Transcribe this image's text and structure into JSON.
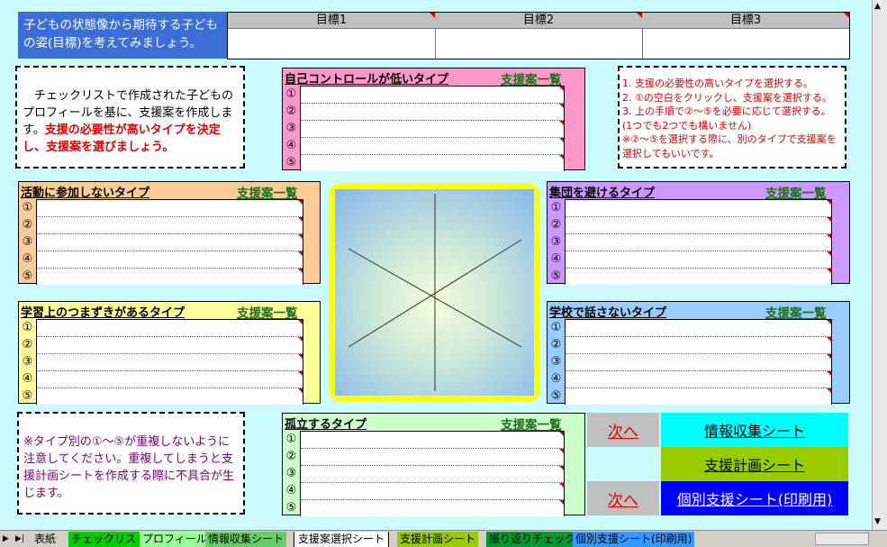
{
  "header": {
    "intro": "子どもの状態像から期待する子どもの姿(目標)を考えてみましょう。",
    "goals": [
      "目標1",
      "目標2",
      "目標3"
    ]
  },
  "instructions": {
    "text_plain": "　チェックリストで作成された子どものプロフィールを基に、支援案を作成します。",
    "text_bold": "支援の必要性が高いタイプを決定し、支援案を選びましょう。"
  },
  "steps": {
    "text": "1. 支援の必要性の高いタイプを選択する。\n2. ①の空白をクリックし、支援案を選択する。\n3. 上の手順で②～⑤を必要に応じて選択する。\n(1つでも2つでも構いません)\n※②～⑤を選択する際に、別のタイプで支援案を選択してもいいです。"
  },
  "note": {
    "text": "※タイプ別の①～⑤が重複しないように注意してください。重複してしまうと支援計画シートを作成する際に不具合が生じます。"
  },
  "link_label": "支援案一覧",
  "numbers": [
    "①",
    "②",
    "③",
    "④",
    "⑤"
  ],
  "panels": {
    "self_control": {
      "title": "自己コントロールが低いタイプ",
      "color": "#ff99cc"
    },
    "no_participation": {
      "title": "活動に参加しないタイプ",
      "color": "#ffcc99"
    },
    "avoid_group": {
      "title": "集団を避けるタイプ",
      "color": "#cc99ff"
    },
    "learning": {
      "title": "学習上のつまずきがあるタイプ",
      "color": "#ffff99"
    },
    "silent_school": {
      "title": "学校で話さないタイプ",
      "color": "#99ccff"
    },
    "isolated": {
      "title": "孤立するタイプ",
      "color": "#ccffcc"
    }
  },
  "nav": {
    "next1": "次へ",
    "next2": "次へ",
    "info_sheet": "情報収集シート",
    "plan_sheet": "支援計画シート",
    "individual_sheet": "個別支援シート(印刷用)"
  },
  "sheet_tabs": [
    "表紙",
    "チェックリスト",
    "プロフィール",
    "情報収集シート",
    "支援案選択シート",
    "支援計画シート",
    "振り返りチェック",
    "個別支援シート(印刷用)"
  ]
}
